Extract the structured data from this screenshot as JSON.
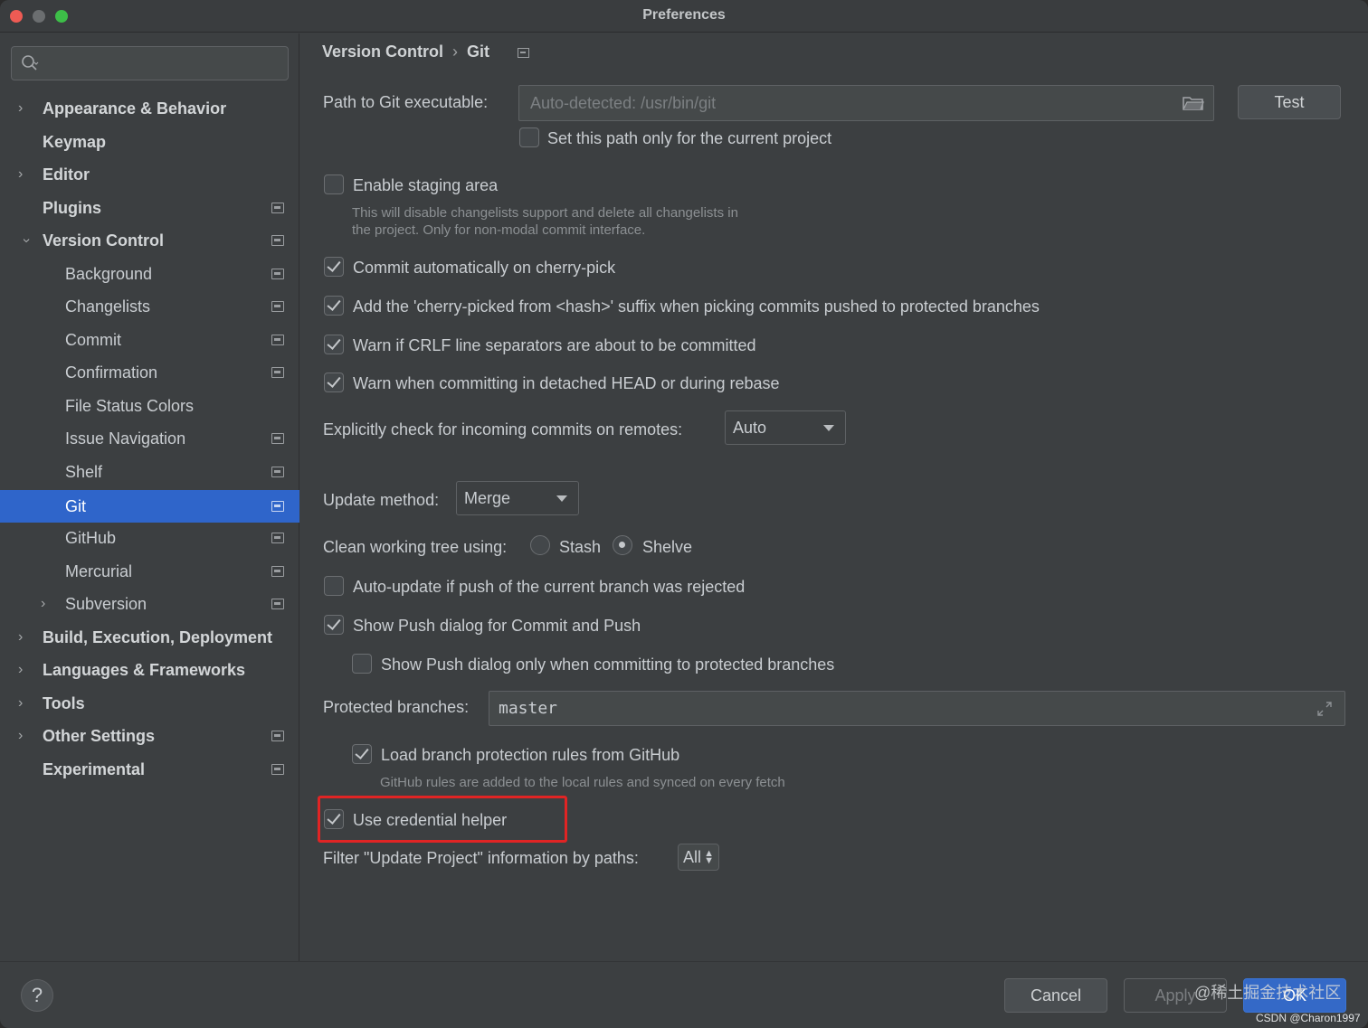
{
  "window": {
    "title": "Preferences"
  },
  "search": {
    "placeholder": ""
  },
  "sidebar": {
    "items": [
      {
        "label": "Appearance & Behavior"
      },
      {
        "label": "Keymap"
      },
      {
        "label": "Editor"
      },
      {
        "label": "Plugins"
      },
      {
        "label": "Version Control"
      },
      {
        "label": "Background"
      },
      {
        "label": "Changelists"
      },
      {
        "label": "Commit"
      },
      {
        "label": "Confirmation"
      },
      {
        "label": "File Status Colors"
      },
      {
        "label": "Issue Navigation"
      },
      {
        "label": "Shelf"
      },
      {
        "label": "Git",
        "selected": true
      },
      {
        "label": "GitHub"
      },
      {
        "label": "Mercurial"
      },
      {
        "label": "Subversion"
      },
      {
        "label": "Build, Execution, Deployment"
      },
      {
        "label": "Languages & Frameworks"
      },
      {
        "label": "Tools"
      },
      {
        "label": "Other Settings"
      },
      {
        "label": "Experimental"
      }
    ]
  },
  "breadcrumb": {
    "parent": "Version Control",
    "separator": "›",
    "current": "Git"
  },
  "settings": {
    "git_path_label": "Path to Git executable:",
    "git_path_placeholder": "Auto-detected: /usr/bin/git",
    "test_button": "Test",
    "path_current_project": {
      "label": "Set this path only for the current project",
      "checked": false
    },
    "staging_area": {
      "label": "Enable staging area",
      "checked": false
    },
    "staging_hint_line1": "This will disable changelists support and delete all changelists in",
    "staging_hint_line2": "the project. Only for non-modal commit interface.",
    "commit_cherry_pick": {
      "label": "Commit automatically on cherry-pick",
      "checked": true
    },
    "cherry_suffix": {
      "label": "Add the 'cherry-picked from <hash>' suffix when picking commits pushed to protected branches",
      "checked": true
    },
    "warn_crlf": {
      "label": "Warn if CRLF line separators are about to be committed",
      "checked": true
    },
    "warn_detached": {
      "label": "Warn when committing in detached HEAD or during rebase",
      "checked": true
    },
    "incoming_label": "Explicitly check for incoming commits on remotes:",
    "incoming_value": "Auto",
    "update_method_label": "Update method:",
    "update_method_value": "Merge",
    "clean_tree_label": "Clean working tree using:",
    "stash_label": "Stash",
    "shelve_label": "Shelve",
    "clean_tree_selected": "Shelve",
    "auto_update": {
      "label": "Auto-update if push of the current branch was rejected",
      "checked": false
    },
    "show_push": {
      "label": "Show Push dialog for Commit and Push",
      "checked": true
    },
    "show_push_protected": {
      "label": "Show Push dialog only when committing to protected branches",
      "checked": false
    },
    "protected_label": "Protected branches:",
    "protected_value": "master",
    "load_rules": {
      "label": "Load branch protection rules from GitHub",
      "checked": true
    },
    "load_rules_hint": "GitHub rules are added to the local rules and synced on every fetch",
    "credential_helper": {
      "label": "Use credential helper",
      "checked": true
    },
    "filter_label": "Filter \"Update Project\" information by paths:",
    "filter_value": "All"
  },
  "footer": {
    "help": "?",
    "cancel": "Cancel",
    "apply": "Apply",
    "ok": "OK",
    "watermark": "@稀土掘金技术社区",
    "watermark_small": "CSDN @Charon1997"
  },
  "colors": {
    "accent": "#2f65ca",
    "highlight_box": "#e02424",
    "background": "#3c3f41"
  }
}
